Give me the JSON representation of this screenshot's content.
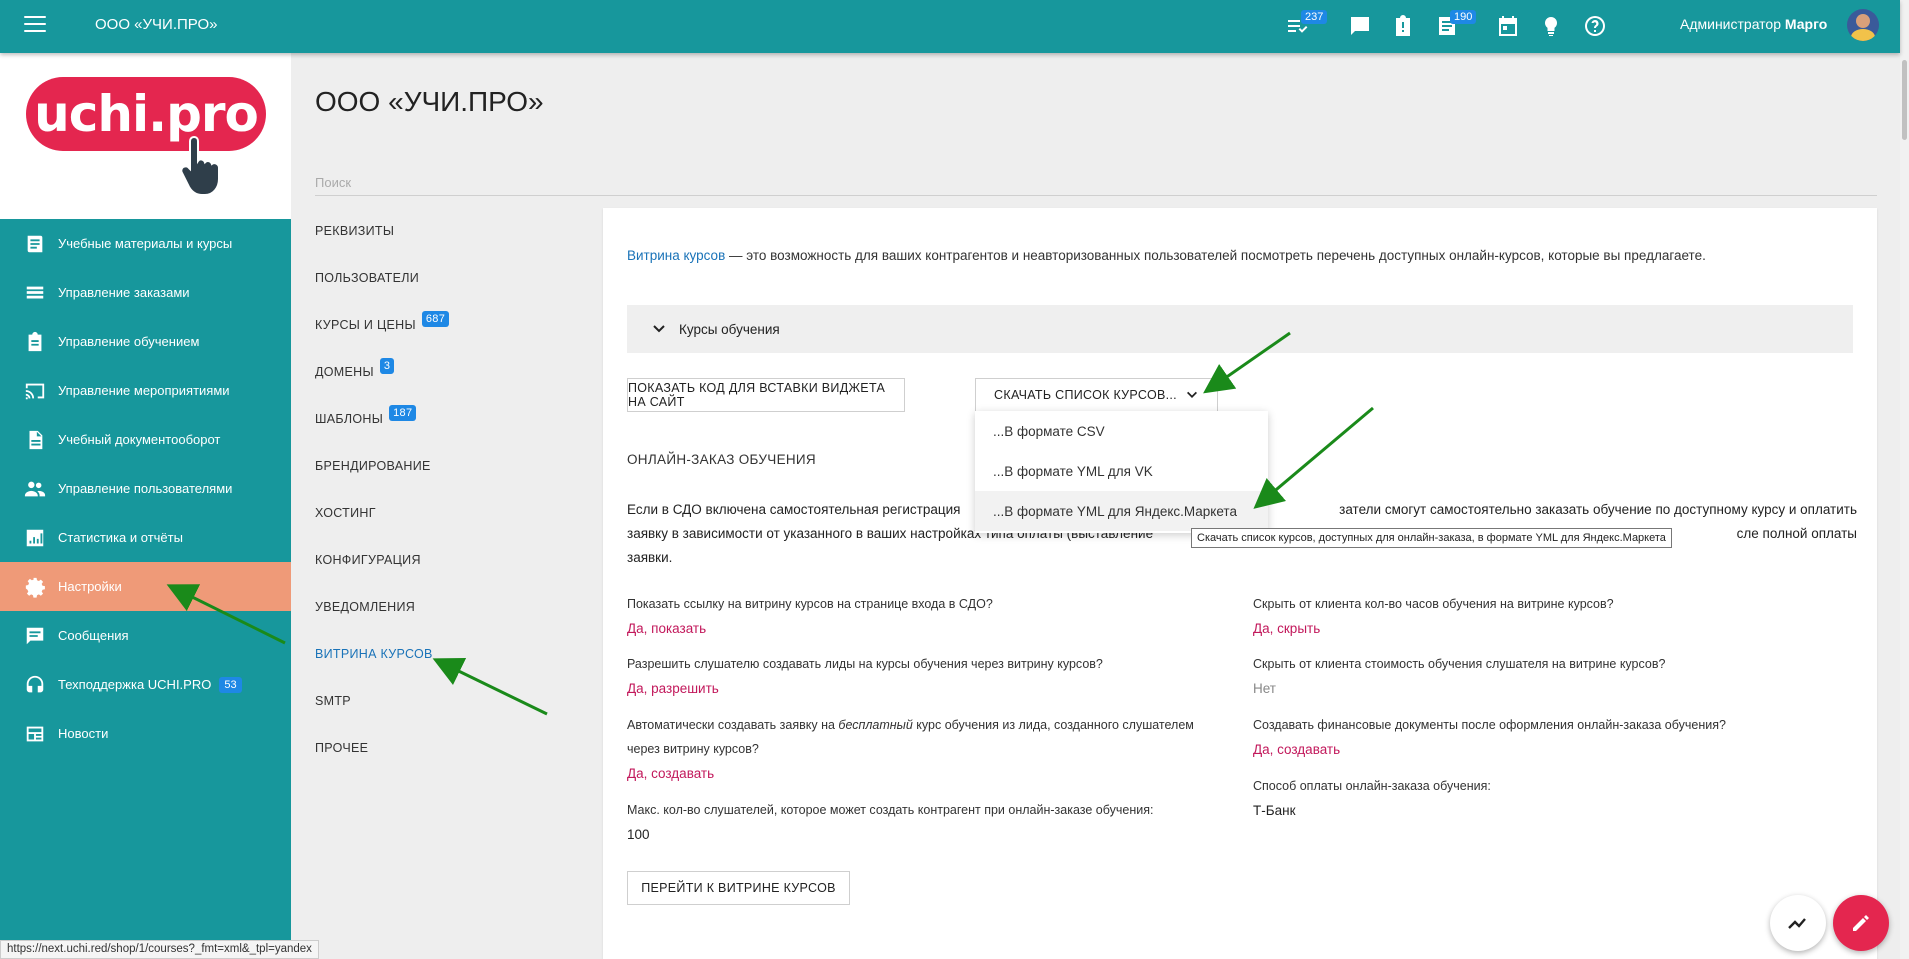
{
  "topbar": {
    "org_name": "ООО «УЧИ.ПРО»",
    "badges": {
      "tasks": "237",
      "documents": "190"
    },
    "user_label": "Администратор",
    "user_name": "Марго"
  },
  "logo": {
    "text": "uchi.pro"
  },
  "sidebar": {
    "items": [
      {
        "label": "Учебные материалы и курсы",
        "icon": "book-icon"
      },
      {
        "label": "Управление заказами",
        "icon": "list-icon"
      },
      {
        "label": "Управление обучением",
        "icon": "clipboard-icon"
      },
      {
        "label": "Управление мероприятиями",
        "icon": "cast-icon"
      },
      {
        "label": "Учебный документооборот",
        "icon": "document-icon"
      },
      {
        "label": "Управление пользователями",
        "icon": "people-icon"
      },
      {
        "label": "Статистика и отчёты",
        "icon": "stats-icon"
      },
      {
        "label": "Настройки",
        "icon": "gear-icon"
      },
      {
        "label": "Сообщения",
        "icon": "message-icon"
      },
      {
        "label": "Техподдержка UCHI.PRO",
        "icon": "support-icon",
        "badge": "53"
      },
      {
        "label": "Новости",
        "icon": "news-icon"
      }
    ]
  },
  "page": {
    "title": "ООО «УЧИ.ПРО»",
    "search_placeholder": "Поиск"
  },
  "settings_nav": {
    "items": [
      {
        "label": "РЕКВИЗИТЫ"
      },
      {
        "label": "ПОЛЬЗОВАТЕЛИ"
      },
      {
        "label": "КУРСЫ И ЦЕНЫ",
        "badge": "687"
      },
      {
        "label": "ДОМЕНЫ",
        "badge": "3"
      },
      {
        "label": "ШАБЛОНЫ",
        "badge": "187"
      },
      {
        "label": "БРЕНДИРОВАНИЕ"
      },
      {
        "label": "ХОСТИНГ"
      },
      {
        "label": "КОНФИГУРАЦИЯ"
      },
      {
        "label": "УВЕДОМЛЕНИЯ"
      },
      {
        "label": "ВИТРИНА КУРСОВ"
      },
      {
        "label": "SMTP"
      },
      {
        "label": "ПРОЧЕЕ"
      }
    ]
  },
  "content": {
    "intro_link": "Витрина курсов",
    "intro_text": " — это возможность для ваших контрагентов и неавторизованных пользователей посмотреть перечень доступных онлайн-курсов, которые вы предлагаете.",
    "collapse_label": "Курсы обучения",
    "widget_button": "ПОКАЗАТЬ КОД ДЛЯ ВСТАВКИ ВИДЖЕТА НА САЙТ",
    "download_button": "СКАЧАТЬ СПИСОК КУРСОВ...",
    "dropdown": [
      "...В формате CSV",
      "...В формате YML для VK",
      "...В формате YML для Яндекс.Маркета"
    ],
    "tooltip": "Скачать список курсов, доступных для онлайн-заказа, в формате YML для Яндекс.Маркета",
    "section_title": "ОНЛАЙН-ЗАКАЗ ОБУЧЕНИЯ",
    "para_line1_start": "Если в СДО включена самостоятельная регистрация",
    "para_line1_end": "затели смогут самостоятельно заказать обучение по доступному курсу и оплатить",
    "para_line2_start": "заявку в зависимости от указанного в ваших настройках типа оплаты (выставление",
    "para_line2_end": "сле полной оплаты",
    "para_line3": "заявки.",
    "left_settings": [
      {
        "q": "Показать ссылку на витрину курсов на странице входа в СДО?",
        "a": "Да, показать"
      },
      {
        "q": "Разрешить слушателю создавать лиды на курсы обучения через витрину курсов?",
        "a": "Да, разрешить"
      },
      {
        "q_start": "Автоматически создавать заявку на ",
        "q_em": "бесплатный",
        "q_end": " курс обучения из лида, созданного слушателем",
        "q_line2": "через витрину курсов?",
        "a": "Да, создавать"
      },
      {
        "q": "Макс. кол-во слушателей, которое может создать контрагент при онлайн-заказе обучения:",
        "a": "100"
      }
    ],
    "right_settings": [
      {
        "q": "Скрыть от клиента кол-во часов обучения на витрине курсов?",
        "a": "Да, скрыть"
      },
      {
        "q": "Скрыть от клиента стоимость обучения слушателя на витрине курсов?",
        "a": "Нет"
      },
      {
        "q": "Создавать финансовые документы после оформления онлайн-заказа обучения?",
        "a": "Да, создавать"
      },
      {
        "q": "Способ оплаты онлайн-заказа обучения:",
        "a": "Т-Банк"
      }
    ],
    "goto_button": "ПЕРЕЙТИ К ВИТРИНЕ КУРСОВ"
  },
  "status_url": "https://next.uchi.red/shop/1/courses?_fmt=xml&_tpl=yandex",
  "colors": {
    "teal": "#17979c",
    "active_nav": "#ef9a78",
    "accent_link": "#c2185b",
    "badge_blue": "#1e88e5",
    "annotation_arrow": "#1a8a1a"
  }
}
